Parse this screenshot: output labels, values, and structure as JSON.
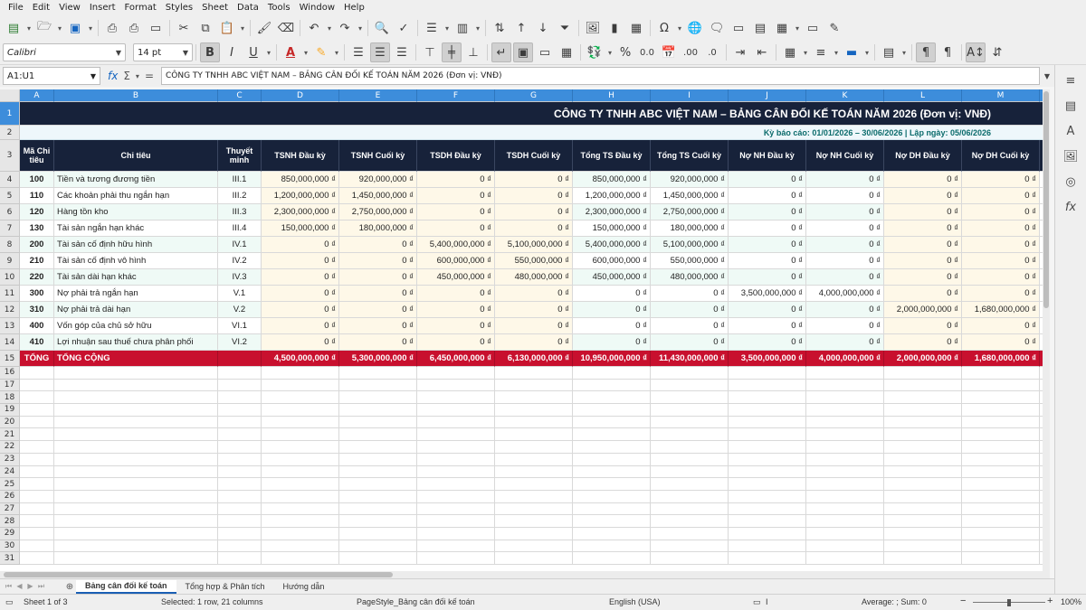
{
  "menu": [
    "File",
    "Edit",
    "View",
    "Insert",
    "Format",
    "Styles",
    "Sheet",
    "Data",
    "Tools",
    "Window",
    "Help"
  ],
  "toolbar": {
    "font_name": "Calibri",
    "font_size": "14 pt",
    "bold": "B",
    "italic": "I",
    "underline": "U",
    "percent": "%",
    "decimal": "0.0",
    "add_decimal": ".00",
    "remove_decimal": ".0"
  },
  "formula_bar": {
    "name_box": "A1:U1",
    "content": "CÔNG TY TNHH ABC VIỆT NAM – BẢNG CÂN ĐỐI KẾ TOÁN NĂM 2026 (Đơn vị: VNĐ)"
  },
  "colors": {
    "header_bg": "#17223a",
    "total_bg": "#c8102e",
    "selection": "#3d8ddb",
    "period_text": "#0b6b6b"
  },
  "sheet": {
    "columns": [
      "A",
      "B",
      "C",
      "D",
      "E",
      "F",
      "G",
      "H",
      "I",
      "J",
      "K",
      "L",
      "M"
    ],
    "title": "CÔNG TY TNHH ABC VIỆT NAM – BẢNG CÂN ĐỐI KẾ TOÁN NĂM 2026 (Đơn vị: VNĐ)",
    "period": "Kỳ báo cáo: 01/01/2026 – 30/06/2026  |  Lập ngày: 05/06/2026",
    "headers": [
      "Mã Chỉ tiêu",
      "Chỉ tiêu",
      "Thuyết minh",
      "TSNH Đầu kỳ",
      "TSNH Cuối kỳ",
      "TSDH Đầu kỳ",
      "TSDH Cuối kỳ",
      "Tổng TS Đầu kỳ",
      "Tổng TS Cuối kỳ",
      "Nợ NH Đầu kỳ",
      "Nợ NH Cuối kỳ",
      "Nợ DH Đầu kỳ",
      "Nợ DH Cuối kỳ"
    ],
    "rows": [
      [
        "100",
        "Tiền và tương đương tiền",
        "III.1",
        "850,000,000 ₫",
        "920,000,000 ₫",
        "0 ₫",
        "0 ₫",
        "850,000,000 ₫",
        "920,000,000 ₫",
        "0 ₫",
        "0 ₫",
        "0 ₫",
        "0 ₫"
      ],
      [
        "110",
        "Các khoản phải thu ngắn hạn",
        "III.2",
        "1,200,000,000 ₫",
        "1,450,000,000 ₫",
        "0 ₫",
        "0 ₫",
        "1,200,000,000 ₫",
        "1,450,000,000 ₫",
        "0 ₫",
        "0 ₫",
        "0 ₫",
        "0 ₫"
      ],
      [
        "120",
        "Hàng tồn kho",
        "III.3",
        "2,300,000,000 ₫",
        "2,750,000,000 ₫",
        "0 ₫",
        "0 ₫",
        "2,300,000,000 ₫",
        "2,750,000,000 ₫",
        "0 ₫",
        "0 ₫",
        "0 ₫",
        "0 ₫"
      ],
      [
        "130",
        "Tài sản ngắn hạn khác",
        "III.4",
        "150,000,000 ₫",
        "180,000,000 ₫",
        "0 ₫",
        "0 ₫",
        "150,000,000 ₫",
        "180,000,000 ₫",
        "0 ₫",
        "0 ₫",
        "0 ₫",
        "0 ₫"
      ],
      [
        "200",
        "Tài sản cố định hữu hình",
        "IV.1",
        "0 ₫",
        "0 ₫",
        "5,400,000,000 ₫",
        "5,100,000,000 ₫",
        "5,400,000,000 ₫",
        "5,100,000,000 ₫",
        "0 ₫",
        "0 ₫",
        "0 ₫",
        "0 ₫"
      ],
      [
        "210",
        "Tài sản cố định vô hình",
        "IV.2",
        "0 ₫",
        "0 ₫",
        "600,000,000 ₫",
        "550,000,000 ₫",
        "600,000,000 ₫",
        "550,000,000 ₫",
        "0 ₫",
        "0 ₫",
        "0 ₫",
        "0 ₫"
      ],
      [
        "220",
        "Tài sản dài hạn khác",
        "IV.3",
        "0 ₫",
        "0 ₫",
        "450,000,000 ₫",
        "480,000,000 ₫",
        "450,000,000 ₫",
        "480,000,000 ₫",
        "0 ₫",
        "0 ₫",
        "0 ₫",
        "0 ₫"
      ],
      [
        "300",
        "Nợ phải trả ngắn hạn",
        "V.1",
        "0 ₫",
        "0 ₫",
        "0 ₫",
        "0 ₫",
        "0 ₫",
        "0 ₫",
        "3,500,000,000 ₫",
        "4,000,000,000 ₫",
        "0 ₫",
        "0 ₫"
      ],
      [
        "310",
        "Nợ phải trả dài hạn",
        "V.2",
        "0 ₫",
        "0 ₫",
        "0 ₫",
        "0 ₫",
        "0 ₫",
        "0 ₫",
        "0 ₫",
        "0 ₫",
        "2,000,000,000 ₫",
        "1,680,000,000 ₫"
      ],
      [
        "400",
        "Vốn góp của chủ sở hữu",
        "VI.1",
        "0 ₫",
        "0 ₫",
        "0 ₫",
        "0 ₫",
        "0 ₫",
        "0 ₫",
        "0 ₫",
        "0 ₫",
        "0 ₫",
        "0 ₫"
      ],
      [
        "410",
        "Lợi nhuận sau thuế chưa phân phối",
        "VI.2",
        "0 ₫",
        "0 ₫",
        "0 ₫",
        "0 ₫",
        "0 ₫",
        "0 ₫",
        "0 ₫",
        "0 ₫",
        "0 ₫",
        "0 ₫"
      ]
    ],
    "total_row": [
      "TỔNG",
      "TỔNG CỘNG",
      "",
      "4,500,000,000 ₫",
      "5,300,000,000 ₫",
      "6,450,000,000 ₫",
      "6,130,000,000 ₫",
      "10,950,000,000 ₫",
      "11,430,000,000 ₫",
      "3,500,000,000 ₫",
      "4,000,000,000 ₫",
      "2,000,000,000 ₫",
      "1,680,000,000 ₫"
    ],
    "row_numbers": [
      "1",
      "2",
      "3",
      "4",
      "5",
      "6",
      "7",
      "8",
      "9",
      "10",
      "11",
      "12",
      "13",
      "14",
      "15",
      "16",
      "17",
      "18",
      "19",
      "20",
      "21",
      "22",
      "23",
      "24",
      "25",
      "26",
      "27",
      "28",
      "29",
      "30",
      "31"
    ]
  },
  "tabs": [
    "Bảng cân đối kế toán",
    "Tổng hợp & Phân tích",
    "Hướng dẫn"
  ],
  "status": {
    "sheet": "Sheet 1 of 3",
    "selection": "Selected: 1 row, 21 columns",
    "page_style": "PageStyle_Bảng cân đối kế toán",
    "language": "English (USA)",
    "summary": "Average: ; Sum: 0",
    "zoom_minus": "−",
    "zoom_plus": "+",
    "zoom": "100%"
  }
}
